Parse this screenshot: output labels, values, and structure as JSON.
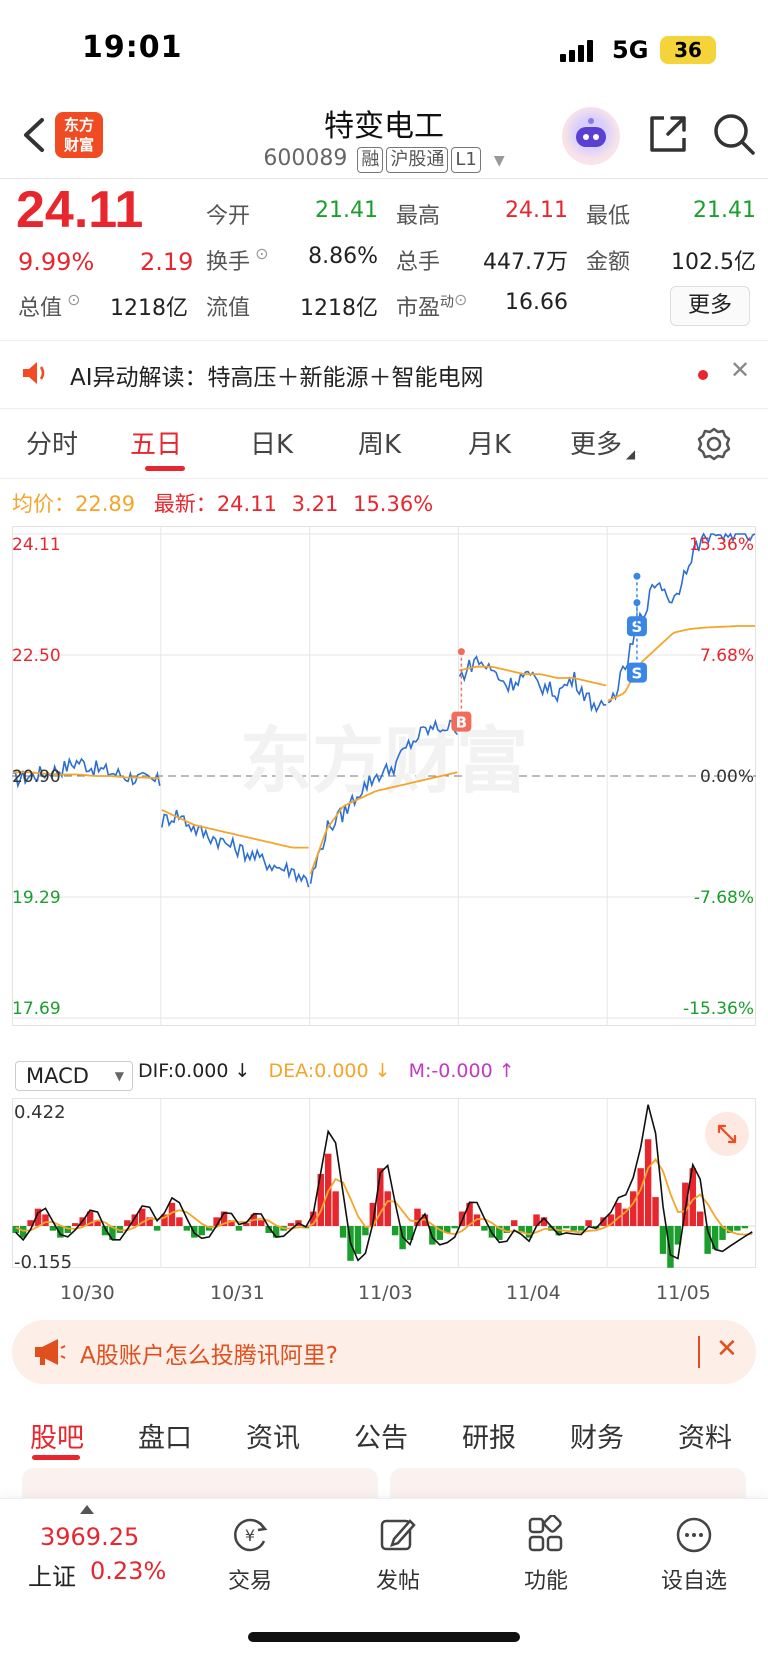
{
  "status_bar": {
    "time": "19:01",
    "network": "5G",
    "battery": "36"
  },
  "header": {
    "logo_line1": "东方",
    "logo_line2": "财富",
    "stock_name": "特变电工",
    "stock_code": "600089",
    "tags": [
      "融",
      "沪股通",
      "L1"
    ]
  },
  "quote": {
    "price": "24.11",
    "change_pct": "9.99%",
    "change": "2.19",
    "open_label": "今开",
    "open": "21.41",
    "high_label": "最高",
    "high": "24.11",
    "low_label": "最低",
    "low": "21.41",
    "turnover_label": "换手",
    "turnover": "8.86%",
    "volume_label": "总手",
    "volume": "447.7万",
    "amount_label": "金额",
    "amount": "102.5亿",
    "mktcap_label": "总值",
    "mktcap": "1218亿",
    "float_label": "流值",
    "float": "1218亿",
    "pe_label": "市盈",
    "pe_sup": "动",
    "pe": "16.66",
    "more_label": "更多"
  },
  "ai_banner": {
    "text": "AI异动解读：特高压＋新能源＋智能电网"
  },
  "chart_tabs": [
    "分时",
    "五日",
    "日K",
    "周K",
    "月K",
    "更多"
  ],
  "legend": {
    "avg_label": "均价：",
    "avg_value": "22.89",
    "latest_label": "最新：",
    "latest_value": "24.11",
    "latest_change": "3.21",
    "latest_pct": "15.36%"
  },
  "chart_data": {
    "type": "line",
    "price_axis": [
      "24.11",
      "22.50",
      "20.90",
      "19.29",
      "17.69"
    ],
    "pct_axis": [
      "15.36%",
      "7.68%",
      "0.00%",
      "-7.68%",
      "-15.36%"
    ],
    "ylim": [
      17.69,
      24.11
    ],
    "prev_close": 20.9,
    "days": [
      "10/30",
      "10/31",
      "11/03",
      "11/04",
      "11/05"
    ],
    "series": [
      {
        "name": "price",
        "color": "#2c6fd1",
        "values": [
          [
            20.85,
            20.9,
            20.95,
            21.0,
            21.1,
            21.0,
            20.95,
            20.9,
            20.85,
            20.82
          ],
          [
            20.3,
            20.4,
            20.2,
            20.1,
            20.0,
            19.9,
            19.8,
            19.7,
            19.65,
            19.5
          ],
          [
            19.5,
            20.2,
            20.4,
            20.7,
            20.9,
            21.0,
            21.3,
            21.5,
            21.55,
            21.55
          ],
          [
            22.2,
            22.45,
            22.3,
            22.1,
            22.25,
            22.1,
            22.0,
            22.2,
            21.9,
            21.75
          ],
          [
            21.8,
            22.3,
            23.0,
            23.5,
            23.2,
            23.8,
            24.11,
            24.11,
            24.11,
            24.11
          ]
        ]
      },
      {
        "name": "avg",
        "color": "#f4a52a",
        "values": [
          [
            20.95,
            20.95,
            20.93,
            20.92,
            20.92,
            20.9,
            20.9,
            20.88,
            20.88,
            20.87
          ],
          [
            20.45,
            20.35,
            20.25,
            20.2,
            20.15,
            20.1,
            20.05,
            20.0,
            19.95,
            19.95
          ],
          [
            19.6,
            20.2,
            20.5,
            20.6,
            20.7,
            20.75,
            20.8,
            20.85,
            20.9,
            20.95
          ],
          [
            22.3,
            22.35,
            22.35,
            22.3,
            22.25,
            22.25,
            22.2,
            22.2,
            22.15,
            22.1
          ],
          [
            21.9,
            22.0,
            22.4,
            22.6,
            22.8,
            22.85,
            22.87,
            22.88,
            22.89,
            22.89
          ]
        ]
      }
    ],
    "markers": [
      {
        "label": "B",
        "color": "#f36b5a"
      },
      {
        "label": "S",
        "color": "#3a86e6"
      },
      {
        "label": "S",
        "color": "#3a86e6"
      }
    ],
    "watermark": "东方财富"
  },
  "macd": {
    "select_label": "MACD",
    "dif": "DIF:0.000 ↓",
    "dea": "DEA:0.000 ↓",
    "m": "M:-0.000 ↑",
    "max": "0.422",
    "min": "-0.155",
    "dif_color": "#111111",
    "dea_color": "#f4a52a",
    "up_color": "#e8262d",
    "down_color": "#1a9e2c",
    "bars": [
      -0.03,
      -0.05,
      0.02,
      0.06,
      0.04,
      -0.02,
      -0.05,
      -0.03,
      0.01,
      0.03,
      0.05,
      0.02,
      -0.04,
      -0.06,
      -0.03,
      0.02,
      0.04,
      0.06,
      0.03,
      -0.02,
      0.04,
      0.08,
      0.03,
      -0.02,
      -0.05,
      -0.04,
      -0.02,
      0.03,
      0.05,
      0.02,
      -0.02,
      0.01,
      0.04,
      0.02,
      -0.03,
      -0.05,
      -0.02,
      0.01,
      0.02,
      -0.01,
      0.05,
      0.18,
      0.25,
      0.12,
      -0.05,
      -0.15,
      -0.12,
      -0.04,
      0.08,
      0.2,
      0.12,
      -0.04,
      -0.1,
      -0.06,
      0.06,
      0.04,
      -0.08,
      -0.06,
      -0.03,
      -0.01,
      0.05,
      0.08,
      0.04,
      -0.02,
      -0.05,
      -0.06,
      -0.03,
      0.02,
      -0.03,
      -0.05,
      0.04,
      0.03,
      -0.02,
      -0.04,
      -0.01,
      -0.02,
      -0.02,
      0.02,
      -0.01,
      0.03,
      0.04,
      0.08,
      0.06,
      0.12,
      0.2,
      0.3,
      0.1,
      -0.12,
      -0.18,
      -0.08,
      0.15,
      0.2,
      0.05,
      -0.12,
      -0.1,
      -0.06,
      -0.03,
      -0.02,
      -0.01,
      0.0
    ]
  },
  "ad_banner": {
    "text": "A股账户怎么投腾讯阿里?"
  },
  "bottom_tabs": [
    "股吧",
    "盘口",
    "资讯",
    "公告",
    "研报",
    "财务",
    "资料"
  ],
  "bottom_nav": {
    "index_value": "3969.25",
    "index_name": "上证",
    "index_pct": "0.23%",
    "items": [
      "交易",
      "发帖",
      "功能",
      "设自选"
    ]
  }
}
